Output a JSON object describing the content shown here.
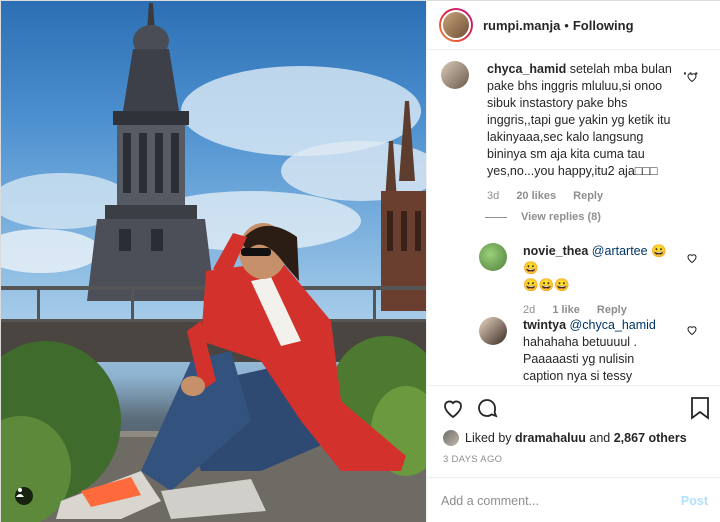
{
  "post": {
    "username": "rumpi.manja",
    "dot": "•",
    "follow_status": "Following"
  },
  "comments": [
    {
      "username": "chyca_hamid",
      "text": "setelah mba bulan pake bhs inggris mluluu,si onoo sibuk instastory pake bhs inggris,,tapi gue yakin yg ketik itu lakinyaaa,sec kalo langsung bininya sm aja kita cuma tau yes,no...you happy,itu2 aja□□□",
      "time": "3d",
      "likes": "20 likes",
      "reply": "Reply",
      "view_replies": "View replies (8)"
    },
    {
      "username": "novie_thea",
      "mention": "@artartee",
      "text_line1": "😀😀",
      "text_line2": "😀😀😀",
      "time": "2d",
      "likes": "1 like",
      "reply": "Reply"
    },
    {
      "username": "twintya",
      "mention": "@chyca_hamid",
      "text": "hahahaha betuuuul . Paaaaasti yg nulisin caption nya si tessy secara"
    }
  ],
  "liked_by": {
    "prefix": "Liked by",
    "user": "dramahaluu",
    "and": "and",
    "others": "2,867 others"
  },
  "date": "3 DAYS AGO",
  "add_comment": {
    "placeholder": "Add a comment...",
    "post_label": "Post"
  },
  "colors": {
    "link": "#003569",
    "muted": "#8e8e8e",
    "post_disabled": "#b2dffc",
    "jacket": "#d3322c"
  },
  "icons": [
    "heart-icon",
    "comment-bubble-icon",
    "bookmark-icon",
    "user-tag-icon",
    "more-options-icon"
  ]
}
